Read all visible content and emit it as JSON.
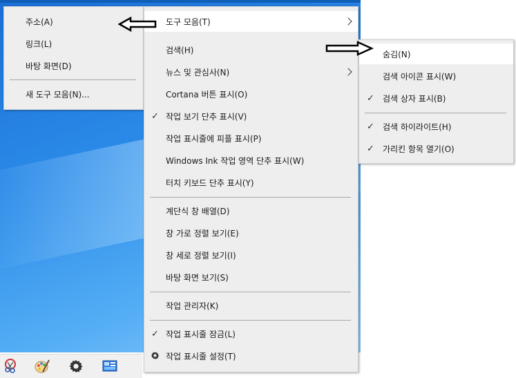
{
  "toolbar_submenu": {
    "items": [
      {
        "label": "주소(A)"
      },
      {
        "label": "링크(L)"
      },
      {
        "label": "바탕 화면(D)"
      },
      {
        "label": "새 도구 모음(N)..."
      }
    ]
  },
  "main_menu": {
    "items": [
      {
        "label": "도구 모음(T)",
        "submenu": true,
        "highlighted": true
      },
      {
        "label": "검색(H)"
      },
      {
        "label": "뉴스 및 관심사(N)",
        "submenu": true
      },
      {
        "label": "Cortana 버튼 표시(O)"
      },
      {
        "label": "작업 보기 단추 표시(V)",
        "checked": true
      },
      {
        "label": "작업 표시줄에 피플 표시(P)"
      },
      {
        "label": "Windows Ink 작업 영역 단추 표시(W)"
      },
      {
        "label": "터치 키보드 단추 표시(Y)"
      },
      {
        "label": "계단식 창 배열(D)"
      },
      {
        "label": "창 가로 정렬 보기(E)"
      },
      {
        "label": "창 세로 정렬 보기(I)"
      },
      {
        "label": "바탕 화면 보기(S)"
      },
      {
        "label": "작업 관리자(K)"
      },
      {
        "label": "작업 표시줄 잠금(L)",
        "checked": true
      },
      {
        "label": "작업 표시줄 설정(T)",
        "icon": "gear-icon"
      }
    ]
  },
  "search_submenu": {
    "items": [
      {
        "label": "숨김(N)",
        "highlighted": true
      },
      {
        "label": "검색 아이콘 표시(W)"
      },
      {
        "label": "검색 상자 표시(B)",
        "checked": true
      },
      {
        "label": "검색 하이라이트(H)",
        "checked": true
      },
      {
        "label": "가리킨 항목 열기(O)",
        "checked": true
      }
    ]
  },
  "glyphs": {
    "check": "✓"
  },
  "taskbar": {
    "icons": [
      "snipping-tool-icon",
      "paint-icon",
      "settings-gear-icon",
      "control-panel-icon"
    ]
  },
  "colors": {
    "menu_bg": "#eeeeee",
    "highlight": "#ffffff",
    "desktop_blue": "#2b8ae8"
  }
}
